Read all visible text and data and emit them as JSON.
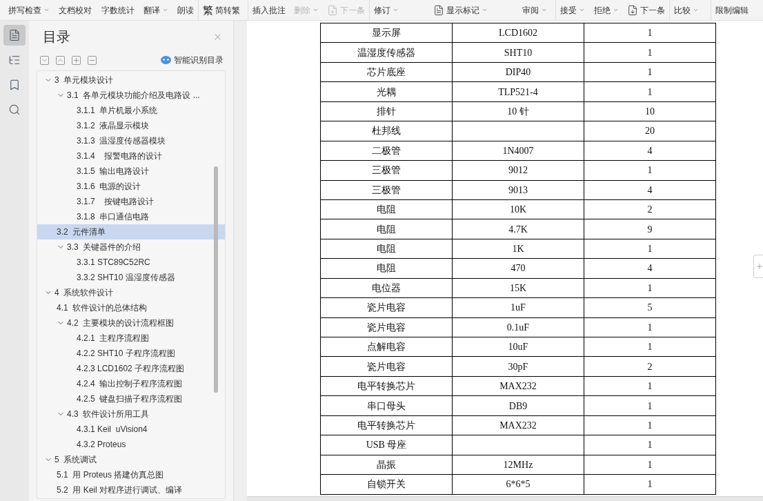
{
  "toolbar": {
    "groups": [
      {
        "items": [
          {
            "label": "拼写检查",
            "dropdown": true,
            "disabled": false
          },
          {
            "label": "文档校对",
            "dropdown": false,
            "disabled": false
          },
          {
            "label": "字数统计",
            "dropdown": false,
            "disabled": false
          },
          {
            "label": "翻译",
            "dropdown": true,
            "disabled": false
          },
          {
            "label": "朗读",
            "dropdown": false,
            "disabled": false
          }
        ]
      },
      {
        "items": [
          {
            "label": "简转繁",
            "dropdown": false,
            "disabled": false,
            "kind": "glyph",
            "glyph": "繁"
          }
        ]
      },
      {
        "items": [
          {
            "label": "插入批注",
            "dropdown": false,
            "disabled": false
          },
          {
            "label": "删除",
            "dropdown": true,
            "disabled": true
          },
          {
            "label": "下一条",
            "dropdown": false,
            "disabled": true,
            "kind": "next"
          }
        ]
      },
      {
        "items": [
          {
            "label": "修订",
            "dropdown": true,
            "disabled": false
          },
          {
            "label": "显示标记",
            "dropdown": true,
            "disabled": false,
            "kind": "markup"
          },
          {
            "label": "审阅",
            "dropdown": true,
            "disabled": false
          }
        ]
      },
      {
        "items": [
          {
            "label": "接受",
            "dropdown": true,
            "disabled": false
          },
          {
            "label": "拒绝",
            "dropdown": true,
            "disabled": false
          },
          {
            "label": "下一条",
            "dropdown": false,
            "disabled": false,
            "kind": "next"
          }
        ]
      },
      {
        "items": [
          {
            "label": "比较",
            "dropdown": true,
            "disabled": false
          }
        ]
      },
      {
        "items": [
          {
            "label": "限制编辑",
            "dropdown": false,
            "disabled": false
          }
        ]
      }
    ]
  },
  "rail": [
    {
      "kind": "toc",
      "selected": true
    },
    {
      "kind": "outline",
      "selected": false
    },
    {
      "kind": "bookmark",
      "selected": false
    },
    {
      "kind": "search",
      "selected": false
    }
  ],
  "toc_panel": {
    "title": "目录",
    "smart_button": "智能识别目录",
    "items": [
      {
        "label": "3  单元模块设计",
        "expanded": true,
        "selected": false,
        "children": [
          {
            "label": "3.1  各单元模块功能介绍及电路设 ...",
            "expanded": true,
            "selected": false,
            "children": [
              {
                "label": "3.1.1  单片机最小系统",
                "selected": false
              },
              {
                "label": "3.1.2  液晶显示模块",
                "selected": false
              },
              {
                "label": "3.1.3  温湿度传感器模块",
                "selected": false
              },
              {
                "label": "3.1.4    报警电路的设计",
                "selected": false
              },
              {
                "label": "3.1.5  输出电路设计",
                "selected": false
              },
              {
                "label": "3.1.6  电源的设计",
                "selected": false
              },
              {
                "label": "3.1.7    按键电路设计",
                "selected": false
              },
              {
                "label": "3.1.8  串口通信电路",
                "selected": false
              }
            ]
          },
          {
            "label": "3.2  元件清单",
            "selected": true
          },
          {
            "label": "3.3  关键器件的介绍",
            "expanded": true,
            "selected": false,
            "children": [
              {
                "label": "3.3.1 STC89C52RC",
                "selected": false
              },
              {
                "label": "3.3.2 SHT10 温湿度传感器",
                "selected": false
              }
            ]
          }
        ]
      },
      {
        "label": "4  系统软件设计",
        "expanded": true,
        "selected": false,
        "children": [
          {
            "label": "4.1  软件设计的总体结构",
            "selected": false
          },
          {
            "label": "4.2  主要模块的设计流程框图",
            "expanded": true,
            "selected": false,
            "children": [
              {
                "label": "4.2.1  主程序流程图",
                "selected": false
              },
              {
                "label": "4.2.2 SHT10 子程序流程图",
                "selected": false
              },
              {
                "label": "4.2.3 LCD1602 子程序流程图",
                "selected": false
              },
              {
                "label": "4.2.4  输出控制子程序流程图",
                "selected": false
              },
              {
                "label": "4.2.5  键盘扫描子程序流程图",
                "selected": false
              }
            ]
          },
          {
            "label": "4.3  软件设计所用工具",
            "expanded": true,
            "selected": false,
            "children": [
              {
                "label": "4.3.1 Keil  uVision4",
                "selected": false
              },
              {
                "label": "4.3.2 Proteus",
                "selected": false
              }
            ]
          }
        ]
      },
      {
        "label": "5  系统调试",
        "expanded": true,
        "selected": false,
        "children": [
          {
            "label": "5.1  用 Proteus 搭建仿真总图",
            "selected": false
          },
          {
            "label": "5.2  用 Keil 对程序进行调试、编译",
            "selected": false
          }
        ]
      }
    ]
  },
  "table": {
    "rows": [
      [
        "显示屏",
        "LCD1602",
        "1"
      ],
      [
        "温湿度传感器",
        "SHT10",
        "1"
      ],
      [
        "芯片底座",
        "DIP40",
        "1"
      ],
      [
        "光耦",
        "TLP521-4",
        "1"
      ],
      [
        "排针",
        "10 针",
        "10"
      ],
      [
        "杜邦线",
        "",
        "20"
      ],
      [
        "二极管",
        "1N4007",
        "4"
      ],
      [
        "三极管",
        "9012",
        "1"
      ],
      [
        "三极管",
        "9013",
        "4"
      ],
      [
        "电阻",
        "10K",
        "2"
      ],
      [
        "电阻",
        "4.7K",
        "9"
      ],
      [
        "电阻",
        "1K",
        "1"
      ],
      [
        "电阻",
        "470",
        "4"
      ],
      [
        "电位器",
        "15K",
        "1"
      ],
      [
        "瓷片电容",
        "1uF",
        "5"
      ],
      [
        "瓷片电容",
        "0.1uF",
        "1"
      ],
      [
        "点解电容",
        "10uF",
        "1"
      ],
      [
        "瓷片电容",
        "30pF",
        "2"
      ],
      [
        "电平转换芯片",
        "MAX232",
        "1"
      ],
      [
        "串口母头",
        "DB9",
        "1"
      ],
      [
        "电平转换芯片",
        "MAX232",
        "1"
      ],
      [
        "USB 母座",
        "",
        "1"
      ],
      [
        "晶振",
        "12MHz",
        "1"
      ],
      [
        "自锁开关",
        "6*6*5",
        "1"
      ]
    ]
  }
}
